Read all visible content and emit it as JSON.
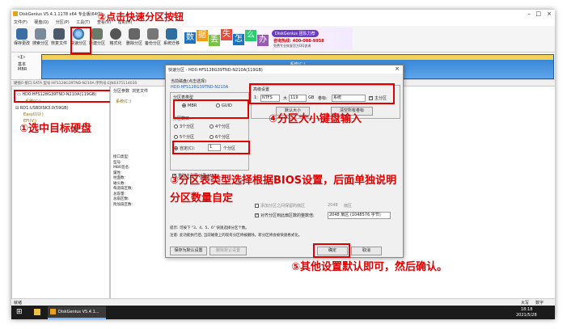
{
  "window": {
    "title": "DiskGenius V5.4.1.1178 x64 专业版(64位)"
  },
  "menu": [
    "文件(F)",
    "硬盘(D)",
    "分区(P)",
    "工具(T)",
    "查看(V)",
    "帮助(H)"
  ],
  "toolbar": [
    "保存更改",
    "搜索分区",
    "恢复文件",
    "快速分区",
    "新建分区",
    "格式化",
    "删除分区",
    "备份分区",
    "系统迁移"
  ],
  "ad": {
    "brand": "DiskGenius 团队力荐",
    "phone": "咨询热线: 400-008-9958",
    "sub": "免费专业恢复官方QQ咨询",
    "chars": [
      "数",
      "据",
      "丢",
      "失",
      "怎",
      "么",
      "办"
    ]
  },
  "disk_bar": {
    "type": "基本\nMBR",
    "partition": "系统(C:)",
    "fs": "NTFS (系统)",
    "size": "119.2GB"
  },
  "disk_info_line": "硬盘0 接口:SATA 型号:HFS128G39TND-N210A 序列号:EJN0375114030",
  "tree": {
    "disk0": "HD0:HFS128G39TND-N210A(119GB)",
    "disk0_part": "系统(C:)",
    "disk1": "RD1:USBDISK3.0(59GB)",
    "disk1_parts": [
      "EasyU(U:)",
      "EFI(V:)"
    ]
  },
  "right_tabs": [
    "分区参数",
    "浏览文件"
  ],
  "right_part": "系统(C:)",
  "details": [
    "接口类型:",
    "型号:",
    "MBR签名:",
    "属性:",
    "",
    "柱面数:",
    "磁头数:",
    "每道扇区数:",
    "总容量:",
    "总扇区数:",
    "附加扇区数:"
  ],
  "dialog": {
    "title": "快速分区 - HD0:HFS128G39TND-N210A(119GB)",
    "current_disk_label": "当前磁盘(点击选择)",
    "current_disk": "HD0:HFS128G39TND-N210A",
    "pt_group": "分区表类型",
    "pt_mbr": "MBR",
    "pt_guid": "GUID",
    "count_group": "分区数目",
    "counts": [
      "3个分区",
      "4个分区",
      "5个分区",
      "6个分区"
    ],
    "custom": "自定(C):",
    "custom_value": "1",
    "custom_unit": "个分区",
    "advanced_group": "高级设置",
    "row_index": "1:",
    "row_fs": "NTFS",
    "row_size_label": "大",
    "row_size": "119",
    "row_unit": "GB",
    "row_label_label": "卷标:",
    "row_label": "系统",
    "row_primary": "主分区",
    "btn_default_size": "默认大小",
    "btn_clear_labels": "清空所有卷标",
    "rebuild_mbr": "重建主引导记录(MBR)",
    "esp_text": "创建新ESP分区",
    "msr_text": "创建MSR分区",
    "keep_text": "保留现有ESP分区",
    "esp_size_text": "ESP分区大小",
    "align_small": "添加分区之间保留的扇区",
    "align_small_value": "2048",
    "align_small_unit": "扇区",
    "align_label": "对齐分区到此扇区数的整数倍:",
    "align_value": "2048 扇区 (1048576 字节)",
    "hint1": "提示: 可按下 \"3、4、5、6\" 快速选择分区个数。",
    "hint2": "注意: 此功能执行后, 当前磁盘上的现有分区将被删除。新分区将会被快速格式化。",
    "btn_save_settings": "保存为默认设置",
    "btn_delete_settings": "删除默认设置",
    "btn_ok": "确定",
    "btn_cancel": "取消"
  },
  "annotations": {
    "a1": "①选中目标硬盘",
    "a2": "②点击快速分区按钮",
    "a3a": "③分区表类型选择根据BIOS设置，后面单独说明",
    "a3b": "分区数量自定",
    "a4": "④分区大小键盘输入",
    "a5": "⑤其他设置默认即可，然后确认。"
  },
  "status": {
    "left": "就绪",
    "right1": "大写",
    "right2": "数字"
  },
  "taskbar": {
    "app": "DiskGenius V5.4.1...",
    "time": "18:18",
    "date": "2021/5/28"
  },
  "colors": {
    "accent_red": "#e00000",
    "partition_blue": "#3b8ad9",
    "partition_yellow": "#f2d05a"
  }
}
